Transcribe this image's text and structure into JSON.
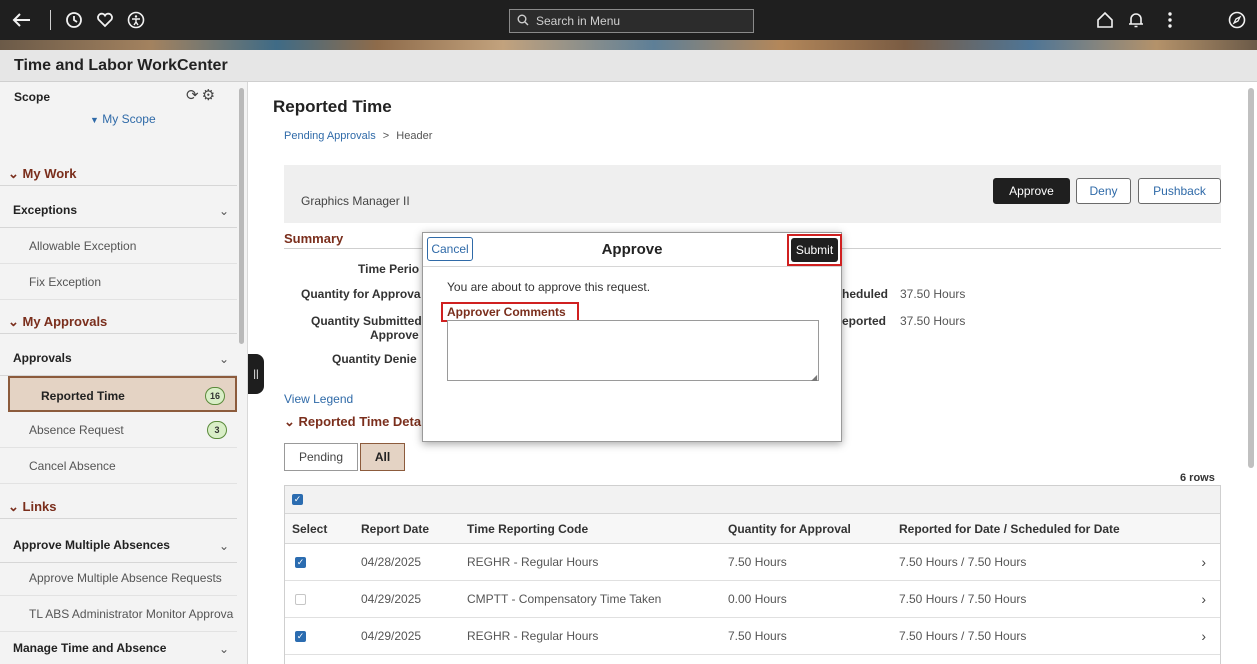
{
  "topbar": {
    "search_placeholder": "Search in Menu",
    "icons": [
      "back-arrow-icon",
      "recent-history-icon",
      "favorites-heart-icon",
      "accessibility-icon",
      "home-icon",
      "notifications-bell-icon",
      "actions-menu-icon",
      "navbar-compass-icon"
    ]
  },
  "app": {
    "title": "Time and Labor WorkCenter"
  },
  "sidebar": {
    "scope_label": "Scope",
    "my_scope": "My Scope",
    "sections": {
      "my_work": "My Work",
      "exceptions": "Exceptions",
      "allowable_exception": "Allowable Exception",
      "fix_exception": "Fix Exception",
      "my_approvals": "My Approvals",
      "approvals": "Approvals",
      "reported_time": "Reported Time",
      "reported_time_count": "16",
      "absence_request": "Absence Request",
      "absence_request_count": "3",
      "cancel_absence": "Cancel Absence",
      "links": "Links",
      "approve_multiple_absences": "Approve Multiple Absences",
      "approve_multiple_absence_requests": "Approve Multiple Absence Requests",
      "tl_abs_admin": "TL ABS Administrator Monitor Approva",
      "manage_time_absence": "Manage Time and Absence"
    }
  },
  "main": {
    "title": "Reported Time",
    "breadcrumb": {
      "link": "Pending Approvals",
      "separator": ">",
      "current": "Header"
    },
    "header_label": "Graphics Manager II",
    "actions": {
      "approve": "Approve",
      "deny": "Deny",
      "pushback": "Pushback"
    },
    "summary": {
      "title": "Summary",
      "time_period": "Time Perio",
      "quantity_for_approval": "Quantity for Approva",
      "quantity_submitted": "Quantity Submitted",
      "approved": "Approve",
      "quantity_denied": "Quantity Denie",
      "scheduled_label": "heduled",
      "scheduled_value": "37.50 Hours",
      "reported_label": "eported",
      "reported_value": "37.50 Hours"
    },
    "view_legend": "View Legend",
    "details_title": "Reported Time Deta",
    "filters": {
      "pending": "Pending",
      "all": "All"
    },
    "rows_count": "6 rows",
    "table": {
      "headers": [
        "Select",
        "Report Date",
        "Time Reporting Code",
        "Quantity for Approval",
        "Reported for Date / Scheduled for Date"
      ],
      "rows": [
        {
          "checked": true,
          "date": "04/28/2025",
          "code": "REGHR - Regular Hours",
          "qty": "7.50 Hours",
          "reported": "7.50 Hours / 7.50 Hours"
        },
        {
          "checked": false,
          "date": "04/29/2025",
          "code": "CMPTT - Compensatory Time Taken",
          "qty": "0.00 Hours",
          "reported": "7.50 Hours / 7.50 Hours"
        },
        {
          "checked": true,
          "date": "04/29/2025",
          "code": "REGHR - Regular Hours",
          "qty": "7.50 Hours",
          "reported": "7.50 Hours / 7.50 Hours"
        }
      ]
    }
  },
  "modal": {
    "cancel": "Cancel",
    "title": "Approve",
    "submit": "Submit",
    "message": "You are about to approve this request.",
    "comments_label": "Approver Comments",
    "comments_value": ""
  },
  "colors": {
    "accent": "#7a2e1c",
    "link": "#2f6aa8",
    "highlight": "#d02020",
    "selected_bg": "#e4d3c4"
  }
}
